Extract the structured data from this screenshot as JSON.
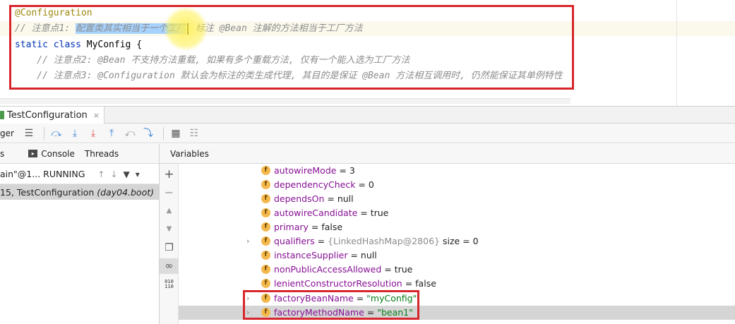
{
  "editor": {
    "line1": "@Configuration",
    "line2_prefix": "// 注意点1: ",
    "line2_selected": "配置类其实相当于一个工厂",
    "line2_suffix": " 标注 @Bean 注解的方法相当于工厂方法",
    "line3_kw": "static class ",
    "line3_name": "MyConfig {",
    "line4": "    // 注意点2: @Bean 不支持方法重载, 如果有多个重载方法, 仅有一个能入选为工厂方法",
    "line5": "    // 注意点3: @Configuration 默认会为标注的类生成代理, 其目的是保证 @Bean 方法相互调用时, 仍然能保证其单例特性"
  },
  "debug": {
    "run_tab_label": "TestConfiguration",
    "run_tab_close": "×",
    "toolbar_label": "ger",
    "tabs": {
      "frames_partial": "s",
      "console": "Console",
      "threads": "Threads",
      "variables": "Variables"
    },
    "thread": {
      "name": "ain\"@1... RUNNING"
    },
    "frame": {
      "text": "15, TestConfiguration",
      "pkg": "(day04.boot)"
    },
    "variables": [
      {
        "name": "autowireMode",
        "eq": " = ",
        "value": "3"
      },
      {
        "name": "dependencyCheck",
        "eq": " = ",
        "value": "0"
      },
      {
        "name": "dependsOn",
        "eq": " = ",
        "value": "null"
      },
      {
        "name": "autowireCandidate",
        "eq": " = ",
        "value": "true"
      },
      {
        "name": "primary",
        "eq": " = ",
        "value": "false"
      },
      {
        "name": "qualifiers",
        "eq": " = ",
        "ref": "{LinkedHashMap@2806}",
        "value": " size = 0"
      },
      {
        "name": "instanceSupplier",
        "eq": " = ",
        "value": "null"
      },
      {
        "name": "nonPublicAccessAllowed",
        "eq": " = ",
        "value": "true"
      },
      {
        "name": "lenientConstructorResolution",
        "eq": " = ",
        "value": "false"
      },
      {
        "name": "factoryBeanName",
        "eq": " = ",
        "value": "\"myConfig\""
      },
      {
        "name": "factoryMethodName",
        "eq": " = ",
        "value": "\"bean1\""
      }
    ]
  },
  "icons": {
    "expand": "›",
    "field": "f"
  },
  "colors": {
    "highlight_red": "#d7262b",
    "selection_blue": "#a6d2ff",
    "string_green": "#067d17",
    "field_purple": "#871094"
  }
}
